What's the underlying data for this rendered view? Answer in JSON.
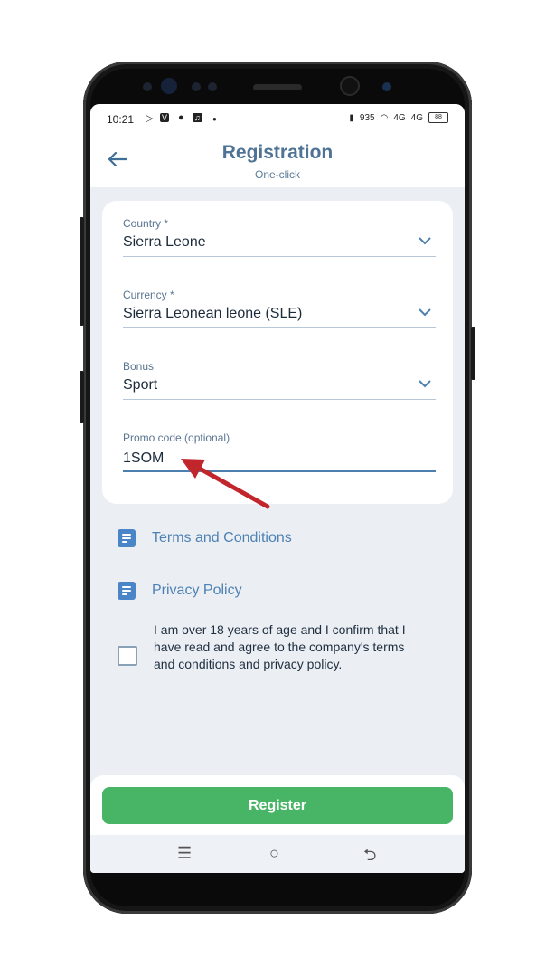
{
  "status_bar": {
    "time": "10:21",
    "left_icons": [
      "media-icon",
      "vpn-icon",
      "dot-icon",
      "music-icon",
      "dot-icon"
    ],
    "right_icons": [
      "vibrate-icon",
      "net-speed",
      "wifi-icon",
      "4g-signal",
      "4g-signal"
    ],
    "net_speed": "935",
    "signal_1": "4G",
    "signal_2": "4G",
    "battery": "88"
  },
  "header": {
    "title": "Registration",
    "subtitle": "One-click",
    "back_icon": "arrow-left-icon"
  },
  "form": {
    "country": {
      "label": "Country *",
      "value": "Sierra Leone"
    },
    "currency": {
      "label": "Currency *",
      "value": "Sierra Leonean leone (SLE)"
    },
    "bonus": {
      "label": "Bonus",
      "value": "Sport"
    },
    "promo": {
      "label": "Promo code (optional)",
      "value": "1SOM"
    }
  },
  "links": {
    "terms": "Terms and Conditions",
    "privacy": "Privacy Policy"
  },
  "agreement": {
    "checked": false,
    "text": "I am over 18 years of age and I confirm that I have read and agree to the company's terms and conditions and privacy policy."
  },
  "register_button": "Register",
  "colors": {
    "accent": "#4e82b4",
    "register_green": "#48b566",
    "annotation_arrow": "#c0262c"
  }
}
